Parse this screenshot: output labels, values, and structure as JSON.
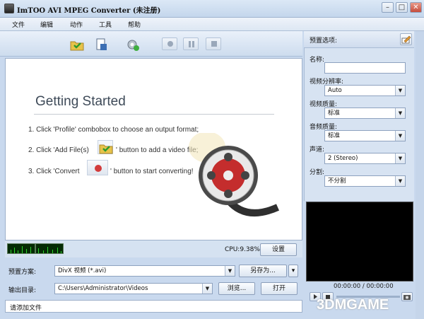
{
  "window": {
    "title": "ImTOO AVI MPEG Converter (未注册)"
  },
  "menu": [
    "文件",
    "编辑",
    "动作",
    "工具",
    "帮助"
  ],
  "getting_started": {
    "title": "Getting Started",
    "step1": "1. Click 'Profile' combobox to choose an output format;",
    "step2_pre": "2. Click 'Add File(s)",
    "step2_post": "' button to add a video file;",
    "step3_pre": "3. Click 'Convert",
    "step3_post": "' button to start converting!"
  },
  "status": {
    "cpu": "CPU:9.38%",
    "settings_label": "设置"
  },
  "profile": {
    "label": "预置方案:",
    "value": "DivX 视频 (*.avi)",
    "save_as_label": "另存为..."
  },
  "output": {
    "label": "输出目录:",
    "value": "C:\\Users\\Administrator\\Videos",
    "browse_label": "浏览...",
    "open_label": "打开"
  },
  "statusbar": {
    "text": "请添加文件"
  },
  "right_panel": {
    "title": "预置选项:",
    "name_label": "名称:",
    "name_value": "",
    "resolution_label": "视频分辨率:",
    "resolution_value": "Auto",
    "video_quality_label": "视频质量:",
    "video_quality_value": "标准",
    "audio_quality_label": "音频质量:",
    "audio_quality_value": "标准",
    "channels_label": "声道:",
    "channels_value": "2 (Stereo)",
    "split_label": "分割:",
    "split_value": "不分割"
  },
  "player": {
    "time": "00:00:00 / 00:00:00"
  },
  "watermark": "3DMGAME",
  "colors": {
    "accent": "#d23b3b",
    "folder": "#e7c34a",
    "panel_bg": "#d7e3f2"
  }
}
